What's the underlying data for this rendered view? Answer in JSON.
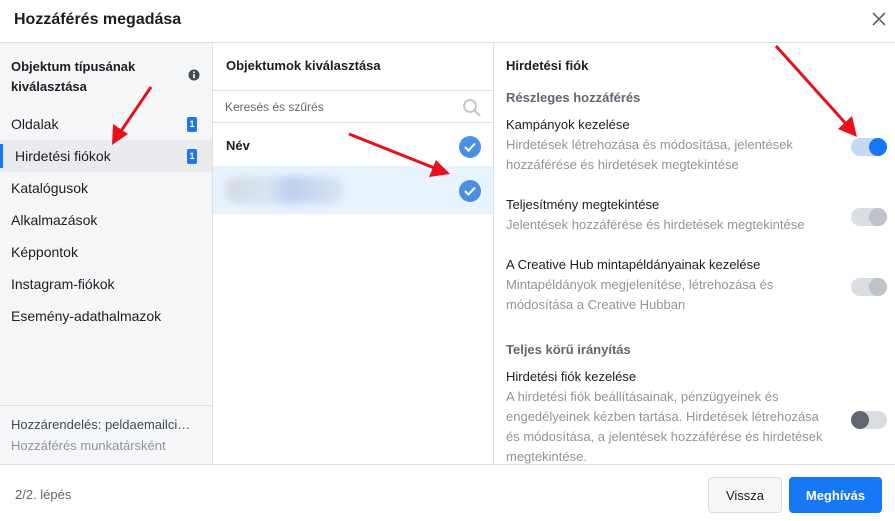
{
  "dialog": {
    "title": "Hozzáférés megadása"
  },
  "object_types": {
    "heading": "Objektum típusának kiválasztása",
    "items": [
      {
        "label": "Oldalak",
        "count": "1",
        "active": false
      },
      {
        "label": "Hirdetési fiókok",
        "count": "1",
        "active": true
      },
      {
        "label": "Katalógusok"
      },
      {
        "label": "Alkalmazások"
      },
      {
        "label": "Képpontok"
      },
      {
        "label": "Instagram-fiókok"
      },
      {
        "label": "Esemény-adathalmazok"
      }
    ],
    "assignment": "Hozzárendelés: peldaemailcim@",
    "assignment_role": "Hozzáférés munkatársként"
  },
  "objects": {
    "heading": "Objektumok kiválasztása",
    "search_placeholder": "Keresés és szűrés",
    "name_header": "Név",
    "selected_account_checked": true
  },
  "permissions": {
    "heading": "Hirdetési fiók",
    "partial_access_title": "Részleges hozzáférés",
    "items": [
      {
        "title": "Kampányok kezelése",
        "description": "Hirdetések létrehozása és módosítása, jelentések hozzáférése és hirdetések megtekintése",
        "state": "on"
      },
      {
        "title": "Teljesítmény megtekintése",
        "description": "Jelentések hozzáférése és hirdetések megtekintése",
        "state": "disabled"
      },
      {
        "title": "A Creative Hub mintapéldányainak kezelése",
        "description": "Mintapéldányok megjelenítése, létrehozása és módosítása a Creative Hubban",
        "state": "disabled"
      }
    ],
    "full_control_title": "Teljes körű irányítás",
    "full_items": [
      {
        "title": "Hirdetési fiók kezelése",
        "description": "A hirdetési fiók beállításainak, pénzügyeinek és engedélyeinek kézben tartása. Hirdetések létrehozása és módosítása, a jelentések hozzáférése és hirdetések megtekintése.",
        "state": "off"
      }
    ]
  },
  "footer": {
    "step": "2/2. lépés",
    "back_label": "Vissza",
    "invite_label": "Meghívás"
  },
  "colors": {
    "accent": "#1877f2",
    "arrow": "#e8101a",
    "check": "#4a90e2"
  },
  "icons": [
    "close-icon",
    "info-icon",
    "search-icon",
    "check-icon"
  ]
}
